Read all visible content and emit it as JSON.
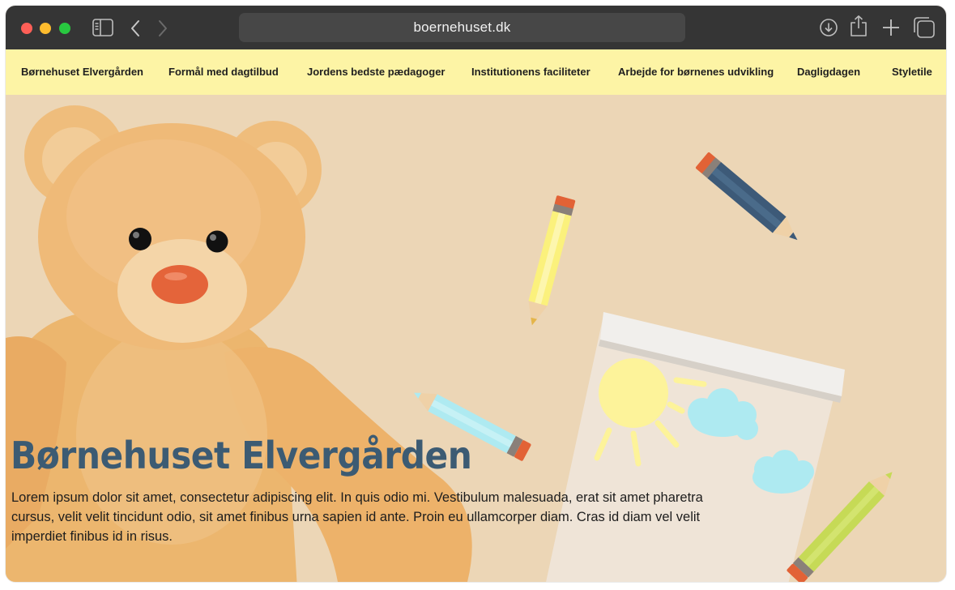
{
  "browser": {
    "url": "boernehuset.dk",
    "icons": [
      "sidebar-icon",
      "back-icon",
      "forward-icon",
      "download-icon",
      "share-icon",
      "new-tab-icon",
      "tabs-overview-icon"
    ]
  },
  "nav": {
    "items": [
      {
        "label": "Børnehuset Elvergården"
      },
      {
        "label": "Formål med dagtilbud"
      },
      {
        "label": "Jordens bedste pædagoger"
      },
      {
        "label": "Institutionens faciliteter"
      },
      {
        "label": "Arbejde for børnenes udvikling"
      },
      {
        "label": "Dagligdagen"
      },
      {
        "label": "Styletile"
      }
    ]
  },
  "hero": {
    "title": "Børnehuset Elvergården",
    "text": "Lorem ipsum dolor sit amet, consectetur adipiscing elit. In quis odio mi. Vestibulum malesuada, erat sit amet pharetra cursus, velit velit tincidunt odio, sit amet finibus urna sapien id ante. Proin eu ullamcorper diam. Cras id diam vel velit imperdiet finibus id in risus."
  },
  "colors": {
    "chrome": "#353535",
    "nav_bg": "#fdf4a5",
    "hero_bg": "#ecd6b6",
    "title": "#3c5b73"
  }
}
